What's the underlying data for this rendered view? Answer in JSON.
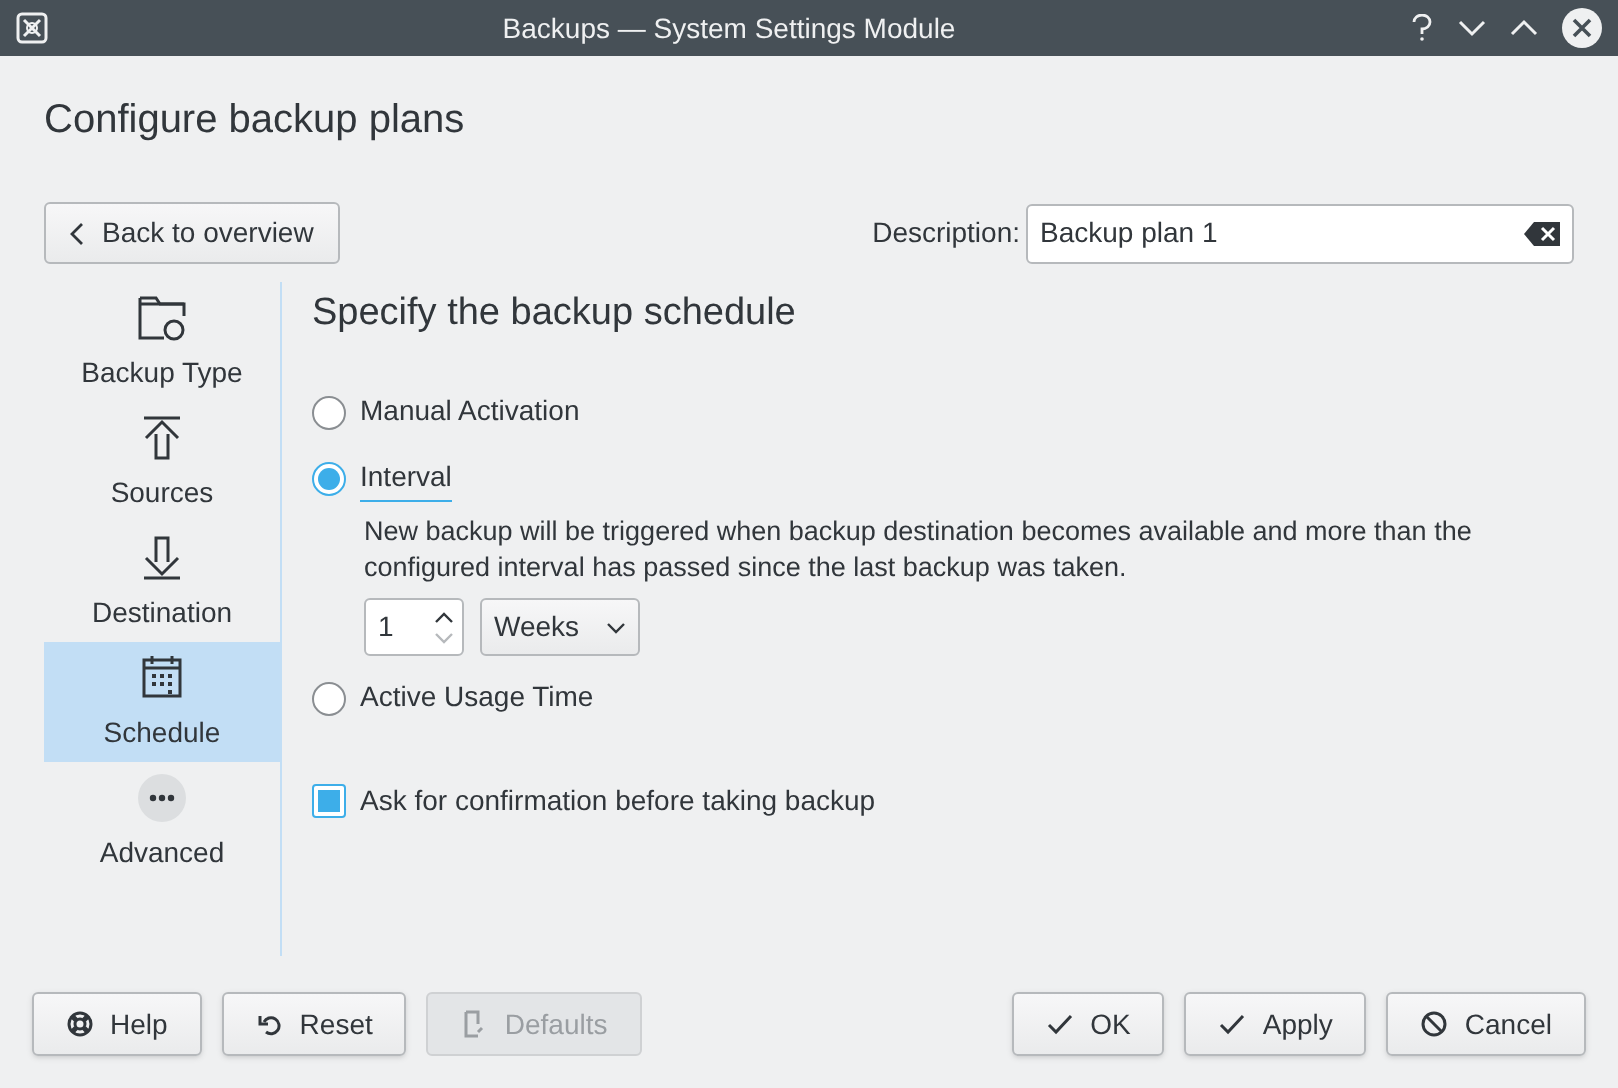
{
  "window": {
    "title": "Backups — System Settings Module"
  },
  "heading": "Configure backup plans",
  "back_button": "Back to overview",
  "description": {
    "label": "Description:",
    "value": "Backup plan 1"
  },
  "sidebar": {
    "items": [
      {
        "label": "Backup Type",
        "selected": false
      },
      {
        "label": "Sources",
        "selected": false
      },
      {
        "label": "Destination",
        "selected": false
      },
      {
        "label": "Schedule",
        "selected": true
      },
      {
        "label": "Advanced",
        "selected": false
      }
    ]
  },
  "page": {
    "title": "Specify the backup schedule",
    "options": [
      {
        "label": "Manual Activation",
        "selected": false,
        "focused": false
      },
      {
        "label": "Interval",
        "selected": true,
        "focused": true,
        "description": "New backup will be triggered when backup destination becomes available and more than the configured interval has passed since the last backup was taken.",
        "spin_value": "1",
        "unit": "Weeks"
      },
      {
        "label": "Active Usage Time",
        "selected": false,
        "focused": false
      }
    ],
    "confirmation": {
      "label": "Ask for confirmation before taking backup",
      "checked": true
    }
  },
  "buttons": {
    "left": [
      {
        "label": "Help",
        "disabled": false
      },
      {
        "label": "Reset",
        "disabled": false
      },
      {
        "label": "Defaults",
        "disabled": true
      }
    ],
    "right": [
      {
        "label": "OK",
        "disabled": false
      },
      {
        "label": "Apply",
        "disabled": false
      },
      {
        "label": "Cancel",
        "disabled": false
      }
    ]
  }
}
